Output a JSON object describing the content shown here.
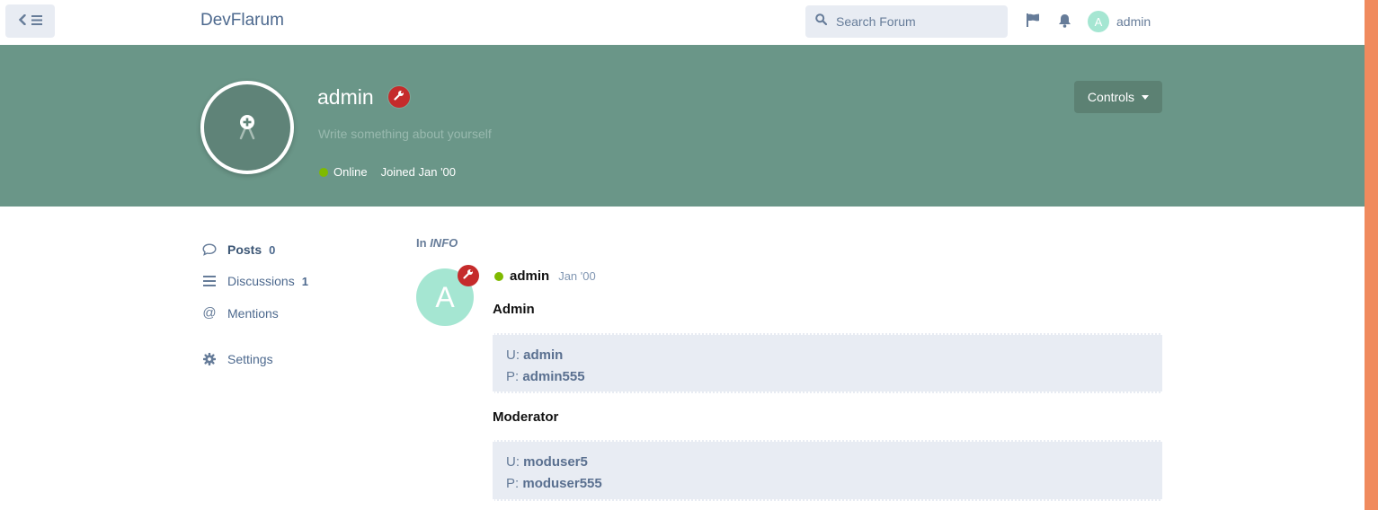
{
  "header": {
    "brand": "DevFlarum",
    "search_placeholder": "Search Forum",
    "user_initial": "A",
    "username": "admin"
  },
  "profile": {
    "name": "admin",
    "bio_placeholder": "Write something about yourself",
    "status": "Online",
    "joined": "Joined Jan '00",
    "controls_label": "Controls"
  },
  "nav": {
    "posts_label": "Posts",
    "posts_count": "0",
    "discussions_label": "Discussions",
    "discussions_count": "1",
    "mentions_label": "Mentions",
    "settings_label": "Settings"
  },
  "post": {
    "in_prefix": "In",
    "tag": "INFO",
    "avatar_initial": "A",
    "author": "admin",
    "date": "Jan '00",
    "sections": [
      {
        "heading": "Admin",
        "user_prefix": "U:",
        "user": "admin",
        "pass_prefix": "P:",
        "pass": "admin555"
      },
      {
        "heading": "Moderator",
        "user_prefix": "U:",
        "user": "moduser5",
        "pass_prefix": "P:",
        "pass": "moduser555"
      }
    ]
  },
  "colors": {
    "hero_bg": "#6a9688",
    "badge_red": "#c52b2b",
    "online_green": "#7fba00",
    "avatar_mint": "#a5e6d2",
    "edge_orange": "#f08a5d"
  }
}
